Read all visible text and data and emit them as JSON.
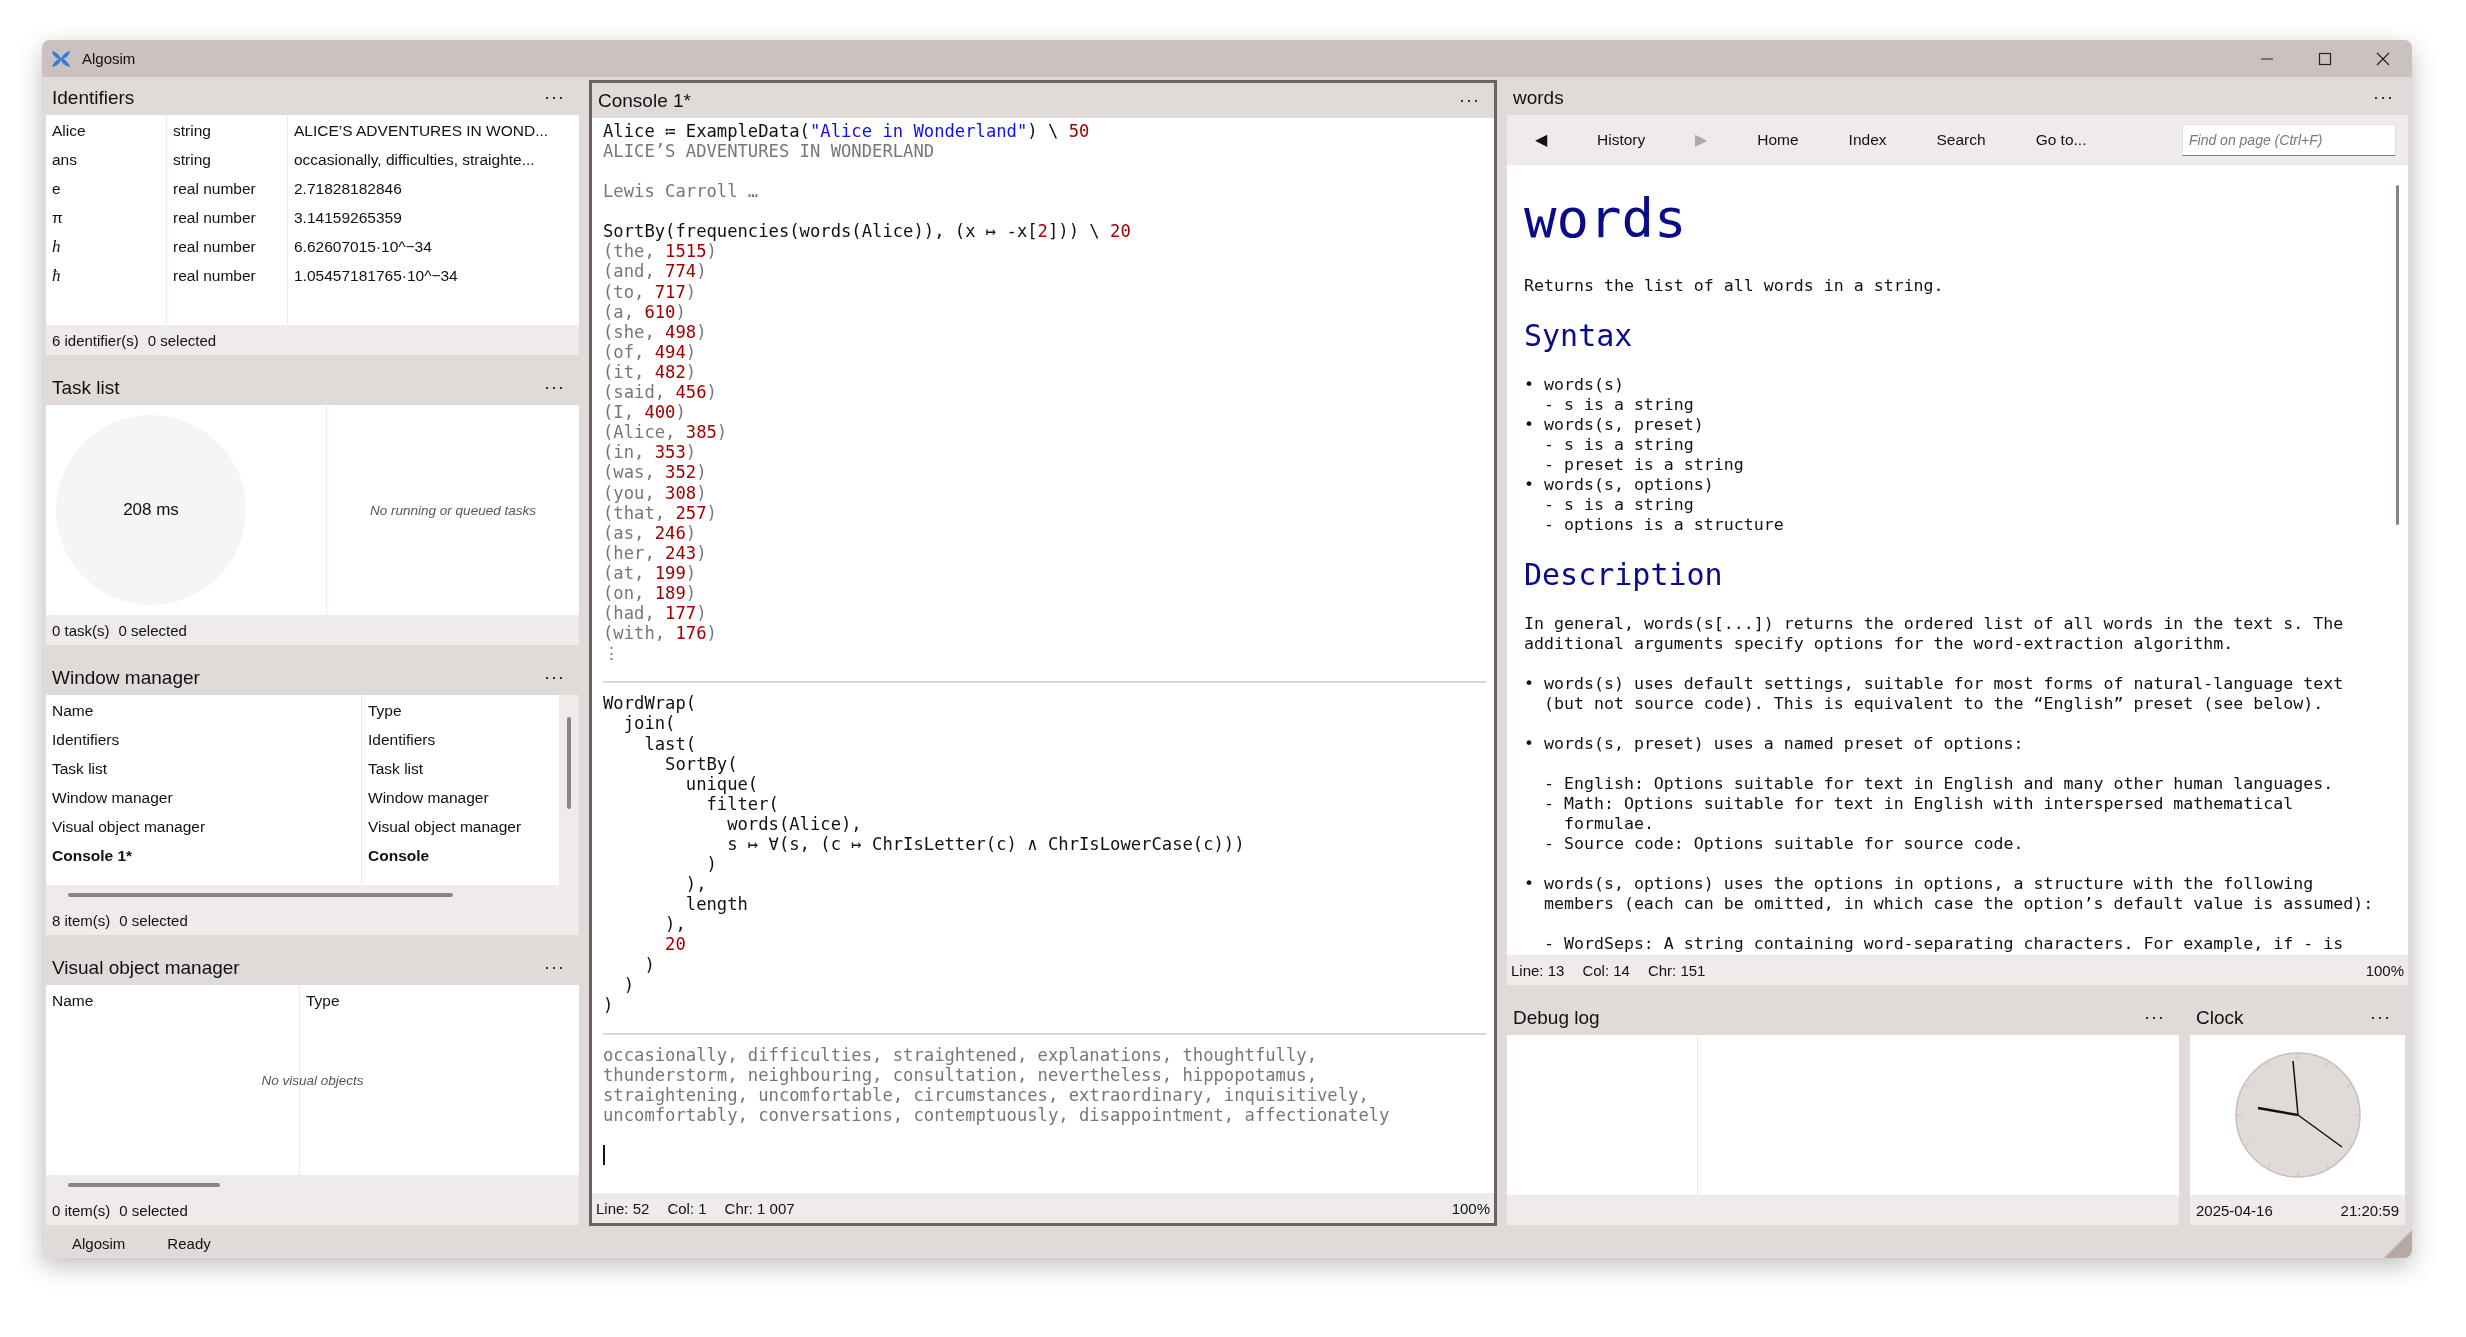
{
  "window": {
    "title": "Algosim"
  },
  "identifiers": {
    "title": "Identifiers",
    "menu": "···",
    "rows": [
      {
        "name": "Alice",
        "type": "string",
        "value": "ALICE’S ADVENTURES IN WOND...",
        "italic": false
      },
      {
        "name": "ans",
        "type": "string",
        "value": "occasionally, difficulties, straighte...",
        "italic": false
      },
      {
        "name": "e",
        "type": "real number",
        "value": "2.71828182846",
        "italic": false
      },
      {
        "name": "π",
        "type": "real number",
        "value": "3.14159265359",
        "italic": false
      },
      {
        "name": "h",
        "type": "real number",
        "value": "6.62607015·10^−34",
        "italic": true
      },
      {
        "name": "ħ",
        "type": "real number",
        "value": "1.05457181765·10^−34",
        "italic": true
      }
    ],
    "footer": [
      "6 identifier(s)",
      "0 selected"
    ]
  },
  "task_list": {
    "title": "Task list",
    "menu": "···",
    "elapsed": "208 ms",
    "empty_message": "No running or queued tasks",
    "footer": [
      "0 task(s)",
      "0 selected"
    ]
  },
  "window_manager": {
    "title": "Window manager",
    "menu": "···",
    "columns": [
      "Name",
      "Type"
    ],
    "rows": [
      {
        "name": "Identifiers",
        "type": "Identifiers",
        "active": false
      },
      {
        "name": "Task list",
        "type": "Task list",
        "active": false
      },
      {
        "name": "Window manager",
        "type": "Window manager",
        "active": false
      },
      {
        "name": "Visual object manager",
        "type": "Visual object manager",
        "active": false
      },
      {
        "name": "Console 1*",
        "type": "Console",
        "active": true
      }
    ],
    "footer": [
      "8 item(s)",
      "0 selected"
    ]
  },
  "visual_object_manager": {
    "title": "Visual object manager",
    "menu": "···",
    "columns": [
      "Name",
      "Type"
    ],
    "empty_message": "No visual objects",
    "footer": [
      "0 item(s)",
      "0 selected"
    ]
  },
  "console": {
    "title": "Console 1*",
    "menu": "···",
    "focused": true,
    "lines": [
      {
        "kind": "input",
        "segments": [
          {
            "kind": "plain",
            "text": "Alice ≔ ExampleData("
          },
          {
            "kind": "str",
            "text": "\"Alice in Wonderland\""
          },
          {
            "kind": "plain",
            "text": ") \\ "
          },
          {
            "kind": "num",
            "text": "50"
          }
        ]
      },
      {
        "kind": "output",
        "text": "ALICE’S ADVENTURES IN WONDERLAND"
      },
      {
        "kind": "output",
        "text": "Lewis Carroll …",
        "space_before": true
      },
      {
        "kind": "input",
        "space_before": true,
        "segments": [
          {
            "kind": "plain",
            "text": "SortBy(frequencies(words(Alice)), (x ↦ -x["
          },
          {
            "kind": "num",
            "text": "2"
          },
          {
            "kind": "plain",
            "text": "])) \\ "
          },
          {
            "kind": "num",
            "text": "20"
          }
        ]
      },
      {
        "kind": "output",
        "segments": [
          {
            "kind": "plain",
            "text": "(the, "
          },
          {
            "kind": "num",
            "text": "1515"
          },
          {
            "kind": "plain",
            "text": ")"
          }
        ]
      },
      {
        "kind": "output",
        "segments": [
          {
            "kind": "plain",
            "text": "(and, "
          },
          {
            "kind": "num",
            "text": "774"
          },
          {
            "kind": "plain",
            "text": ")"
          }
        ]
      },
      {
        "kind": "output",
        "segments": [
          {
            "kind": "plain",
            "text": "(to, "
          },
          {
            "kind": "num",
            "text": "717"
          },
          {
            "kind": "plain",
            "text": ")"
          }
        ]
      },
      {
        "kind": "output",
        "segments": [
          {
            "kind": "plain",
            "text": "(a, "
          },
          {
            "kind": "num",
            "text": "610"
          },
          {
            "kind": "plain",
            "text": ")"
          }
        ]
      },
      {
        "kind": "output",
        "segments": [
          {
            "kind": "plain",
            "text": "(she, "
          },
          {
            "kind": "num",
            "text": "498"
          },
          {
            "kind": "plain",
            "text": ")"
          }
        ]
      },
      {
        "kind": "output",
        "segments": [
          {
            "kind": "plain",
            "text": "(of, "
          },
          {
            "kind": "num",
            "text": "494"
          },
          {
            "kind": "plain",
            "text": ")"
          }
        ]
      },
      {
        "kind": "output",
        "segments": [
          {
            "kind": "plain",
            "text": "(it, "
          },
          {
            "kind": "num",
            "text": "482"
          },
          {
            "kind": "plain",
            "text": ")"
          }
        ]
      },
      {
        "kind": "output",
        "segments": [
          {
            "kind": "plain",
            "text": "(said, "
          },
          {
            "kind": "num",
            "text": "456"
          },
          {
            "kind": "plain",
            "text": ")"
          }
        ]
      },
      {
        "kind": "output",
        "segments": [
          {
            "kind": "plain",
            "text": "(I, "
          },
          {
            "kind": "num",
            "text": "400"
          },
          {
            "kind": "plain",
            "text": ")"
          }
        ]
      },
      {
        "kind": "output",
        "segments": [
          {
            "kind": "plain",
            "text": "(Alice, "
          },
          {
            "kind": "num",
            "text": "385"
          },
          {
            "kind": "plain",
            "text": ")"
          }
        ]
      },
      {
        "kind": "output",
        "segments": [
          {
            "kind": "plain",
            "text": "(in, "
          },
          {
            "kind": "num",
            "text": "353"
          },
          {
            "kind": "plain",
            "text": ")"
          }
        ]
      },
      {
        "kind": "output",
        "segments": [
          {
            "kind": "plain",
            "text": "(was, "
          },
          {
            "kind": "num",
            "text": "352"
          },
          {
            "kind": "plain",
            "text": ")"
          }
        ]
      },
      {
        "kind": "output",
        "segments": [
          {
            "kind": "plain",
            "text": "(you, "
          },
          {
            "kind": "num",
            "text": "308"
          },
          {
            "kind": "plain",
            "text": ")"
          }
        ]
      },
      {
        "kind": "output",
        "segments": [
          {
            "kind": "plain",
            "text": "(that, "
          },
          {
            "kind": "num",
            "text": "257"
          },
          {
            "kind": "plain",
            "text": ")"
          }
        ]
      },
      {
        "kind": "output",
        "segments": [
          {
            "kind": "plain",
            "text": "(as, "
          },
          {
            "kind": "num",
            "text": "246"
          },
          {
            "kind": "plain",
            "text": ")"
          }
        ]
      },
      {
        "kind": "output",
        "segments": [
          {
            "kind": "plain",
            "text": "(her, "
          },
          {
            "kind": "num",
            "text": "243"
          },
          {
            "kind": "plain",
            "text": ")"
          }
        ]
      },
      {
        "kind": "output",
        "segments": [
          {
            "kind": "plain",
            "text": "(at, "
          },
          {
            "kind": "num",
            "text": "199"
          },
          {
            "kind": "plain",
            "text": ")"
          }
        ]
      },
      {
        "kind": "output",
        "segments": [
          {
            "kind": "plain",
            "text": "(on, "
          },
          {
            "kind": "num",
            "text": "189"
          },
          {
            "kind": "plain",
            "text": ")"
          }
        ]
      },
      {
        "kind": "output",
        "segments": [
          {
            "kind": "plain",
            "text": "(had, "
          },
          {
            "kind": "num",
            "text": "177"
          },
          {
            "kind": "plain",
            "text": ")"
          }
        ]
      },
      {
        "kind": "output",
        "segments": [
          {
            "kind": "plain",
            "text": "(with, "
          },
          {
            "kind": "num",
            "text": "176"
          },
          {
            "kind": "plain",
            "text": ")"
          }
        ]
      },
      {
        "kind": "output",
        "text": "⋮"
      },
      {
        "kind": "rule"
      },
      {
        "kind": "input",
        "text": "WordWrap("
      },
      {
        "kind": "input",
        "text": "  join("
      },
      {
        "kind": "input",
        "text": "    last("
      },
      {
        "kind": "input",
        "text": "      SortBy("
      },
      {
        "kind": "input",
        "text": "        unique("
      },
      {
        "kind": "input",
        "text": "          filter("
      },
      {
        "kind": "input",
        "text": "            words(Alice),"
      },
      {
        "kind": "input",
        "text": "            s ↦ ∀(s, (c ↦ ChrIsLetter(c) ∧ ChrIsLowerCase(c)))"
      },
      {
        "kind": "input",
        "text": "          )"
      },
      {
        "kind": "input",
        "text": "        ),"
      },
      {
        "kind": "input",
        "text": "        length"
      },
      {
        "kind": "input",
        "text": "      ),"
      },
      {
        "kind": "input",
        "segments": [
          {
            "kind": "num",
            "text": "      20"
          }
        ]
      },
      {
        "kind": "input",
        "text": "    )"
      },
      {
        "kind": "input",
        "text": "  )"
      },
      {
        "kind": "input",
        "text": ")"
      },
      {
        "kind": "rule"
      },
      {
        "kind": "output",
        "text": "occasionally, difficulties, straightened, explanations, thoughtfully,"
      },
      {
        "kind": "output",
        "text": "thunderstorm, neighbouring, consultation, nevertheless, hippopotamus,"
      },
      {
        "kind": "output",
        "text": "straightening, uncomfortable, circumstances, extraordinary, inquisitively,"
      },
      {
        "kind": "output",
        "text": "uncomfortably, conversations, contemptuously, disappointment, affectionately"
      },
      {
        "kind": "caret",
        "space_before": true
      }
    ],
    "status": [
      "Line: 52",
      "Col: 1",
      "Chr: 1 007"
    ],
    "zoom": "100%"
  },
  "help": {
    "title": "words",
    "menu": "···",
    "toolbar": [
      {
        "label": "◀",
        "disabled": false
      },
      {
        "label": "History",
        "disabled": false
      },
      {
        "label": "▶",
        "disabled": true
      },
      {
        "label": "Home",
        "disabled": false
      },
      {
        "label": "Index",
        "disabled": false
      },
      {
        "label": "Search",
        "disabled": false
      },
      {
        "label": "Go to...",
        "disabled": false
      }
    ],
    "search": {
      "placeholder": "Find on page (Ctrl+F)"
    },
    "content": [
      {
        "kind": "title",
        "text": "words"
      },
      {
        "kind": "text",
        "text": "Returns the list of all words in a string."
      },
      {
        "kind": "heading",
        "text": "Syntax"
      },
      {
        "kind": "bullet",
        "text": "• words(s)"
      },
      {
        "kind": "dash",
        "text": "- s is a string"
      },
      {
        "kind": "bullet",
        "text": "• words(s, preset)"
      },
      {
        "kind": "dash",
        "text": "- s is a string"
      },
      {
        "kind": "dash",
        "text": "- preset is a string"
      },
      {
        "kind": "bullet",
        "text": "• words(s, options)"
      },
      {
        "kind": "dash",
        "text": "- s is a string"
      },
      {
        "kind": "dash",
        "text": "- options is a structure"
      },
      {
        "kind": "heading",
        "text": "Description"
      },
      {
        "kind": "text",
        "text": "In general, words(s[...]) returns the ordered list of all words in the text s. The"
      },
      {
        "kind": "text",
        "text": "additional arguments specify options for the word-extraction algorithm."
      },
      {
        "kind": "bullet",
        "text": "• words(s) uses default settings, suitable for most forms of natural-language text",
        "space_before": true
      },
      {
        "kind": "bullet-cont",
        "text": "(but not source code). This is equivalent to the “English” preset (see below)."
      },
      {
        "kind": "bullet",
        "text": "• words(s, preset) uses a named preset of options:",
        "space_before": true
      },
      {
        "kind": "dash",
        "text": "- English: Options suitable for text in English and many other human languages.",
        "space_before": true
      },
      {
        "kind": "dash",
        "text": "- Math: Options suitable for text in English with interspersed mathematical"
      },
      {
        "kind": "dash-cont",
        "text": "formulae."
      },
      {
        "kind": "dash",
        "text": "- Source code: Options suitable for source code."
      },
      {
        "kind": "bullet",
        "text": "• words(s, options) uses the options in options, a structure with the following",
        "space_before": true
      },
      {
        "kind": "bullet-cont",
        "text": "members (each can be omitted, in which case the option’s default value is assumed):"
      },
      {
        "kind": "dash",
        "text": "- WordSeps: A string containing word-separating characters. For example, if - is",
        "space_before": true
      }
    ],
    "status": [
      "Line: 13",
      "Col: 14",
      "Chr: 151"
    ],
    "zoom": "100%"
  },
  "debug_log": {
    "title": "Debug log",
    "menu": "···"
  },
  "clock": {
    "title": "Clock",
    "menu": "···",
    "date": "2025-04-16",
    "time": "21:20:59"
  },
  "status_bar": [
    "Algosim",
    "Ready"
  ]
}
